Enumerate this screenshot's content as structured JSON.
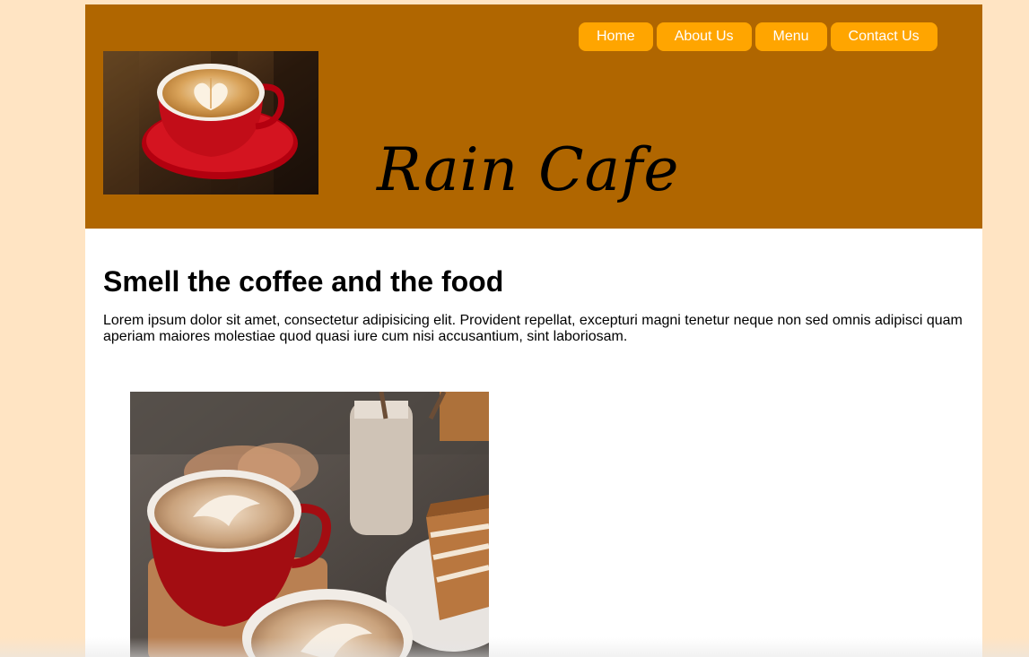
{
  "header": {
    "brand_title": "Rain Cafe",
    "background_color": "#b06600",
    "nav": {
      "button_color": "#ffa500",
      "items": [
        {
          "label": "Home"
        },
        {
          "label": "About Us"
        },
        {
          "label": "Menu"
        },
        {
          "label": "Contact Us"
        }
      ]
    },
    "logo_image": "latte-art-coffee-cup-photo"
  },
  "main": {
    "headline": "Smell the coffee and the food",
    "intro": "Lorem ipsum dolor sit amet, consectetur adipisicing elit. Provident repellat, excepturi magni tenetur neque non sed omnis adipisci quam aperiam maiores molestiae quod quasi iure cum nisi accusantium, sint laboriosam.",
    "feature_image": "coffee-and-cake-photo"
  },
  "colors": {
    "page_background": "#ffe4c3",
    "content_background": "#ffffff"
  }
}
